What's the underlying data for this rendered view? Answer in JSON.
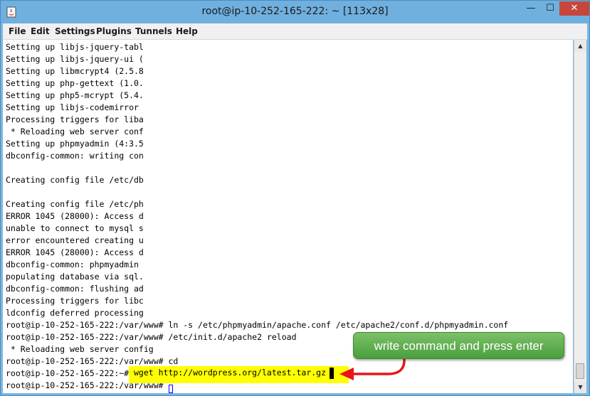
{
  "window": {
    "title": "root@ip-10-252-165-222: ~ [113x28]",
    "minimize_glyph": "—",
    "maximize_glyph": "☐",
    "close_glyph": "✕",
    "icon": "java-app-icon"
  },
  "menu": [
    {
      "label": "File"
    },
    {
      "label": "Edit"
    },
    {
      "label": "Settings"
    },
    {
      "label": "Plugins"
    },
    {
      "label": "Tunnels"
    },
    {
      "label": "Help"
    }
  ],
  "terminal": {
    "lines": [
      "Setting up libjs-jquery-tabl",
      "Setting up libjs-jquery-ui (",
      "Setting up libmcrypt4 (2.5.8",
      "Setting up php-gettext (1.0.",
      "Setting up php5-mcrypt (5.4.",
      "Setting up libjs-codemirror",
      "Processing triggers for liba",
      " * Reloading web server conf",
      "Setting up phpmyadmin (4:3.5",
      "dbconfig-common: writing con",
      "",
      "Creating config file /etc/db",
      "",
      "",
      "Creating config file /etc/ph",
      "ERROR 1045 (28000): Access d",
      "unable to connect to mysql s",
      "error encountered creating u",
      "ERROR 1045 (28000): Access d",
      "dbconfig-common: phpmyadmin",
      "populating database via sql.",
      "dbconfig-common: flushing ad",
      "Processing triggers for libc",
      "ldconfig deferred processing",
      "root@ip-10-252-165-222:/var/www# ln -s /etc/phpmyadmin/apache.conf /etc/apache2/conf.d/phpmyadmin.conf",
      "root@ip-10-252-165-222:/var/www# /etc/init.d/apache2 reload",
      " * Reloading web server config",
      "root@ip-10-252-165-222:/var/www# cd",
      "root@ip-10-252-165-222:~# ",
      "root@ip-10-252-165-222:/var/www# "
    ],
    "highlighted_command": "wget http://wordpress.org/latest.tar.gz"
  },
  "scrollbar": {
    "up_glyph": "▲",
    "down_glyph": "▼"
  },
  "annotation": {
    "text": "write command and press enter",
    "color": "#5bab4a",
    "arrow_color": "#e8141a",
    "highlight_color": "#ffff00"
  }
}
